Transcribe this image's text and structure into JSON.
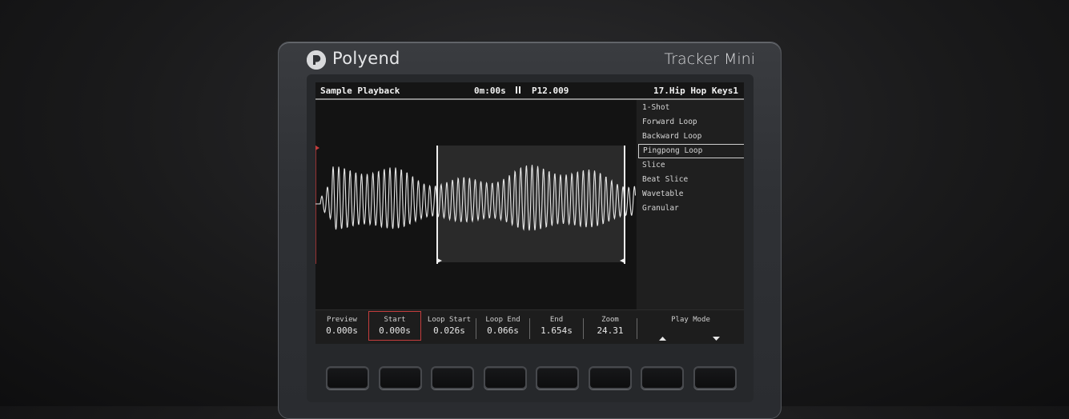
{
  "device": {
    "brand": "Polyend",
    "model": "Tracker Mini"
  },
  "screen": {
    "title": "Sample Playback",
    "time": "0m:00s",
    "transport_icon": "pause-icon",
    "pattern": "P12.009",
    "instrument": "17.Hip Hop Keys1",
    "play_modes": [
      "1-Shot",
      "Forward Loop",
      "Backward Loop",
      "Pingpong Loop",
      "Slice",
      "Beat Slice",
      "Wavetable",
      "Granular"
    ],
    "selected_play_mode": "Pingpong Loop",
    "params": [
      {
        "label": "Preview",
        "value": "0.000s"
      },
      {
        "label": "Start",
        "value": "0.000s"
      },
      {
        "label": "Loop Start",
        "value": "0.026s"
      },
      {
        "label": "Loop End",
        "value": "0.066s"
      },
      {
        "label": "End",
        "value": "1.654s"
      },
      {
        "label": "Zoom",
        "value": "24.31"
      }
    ],
    "play_mode_label": "Play Mode",
    "active_param": "Start"
  },
  "colors": {
    "screen_bg": "#151515",
    "text": "#f2f2f2",
    "active_highlight": "#c43d3d",
    "waveform": "#e6e6e6",
    "loop_region": "#2a2a2a"
  }
}
